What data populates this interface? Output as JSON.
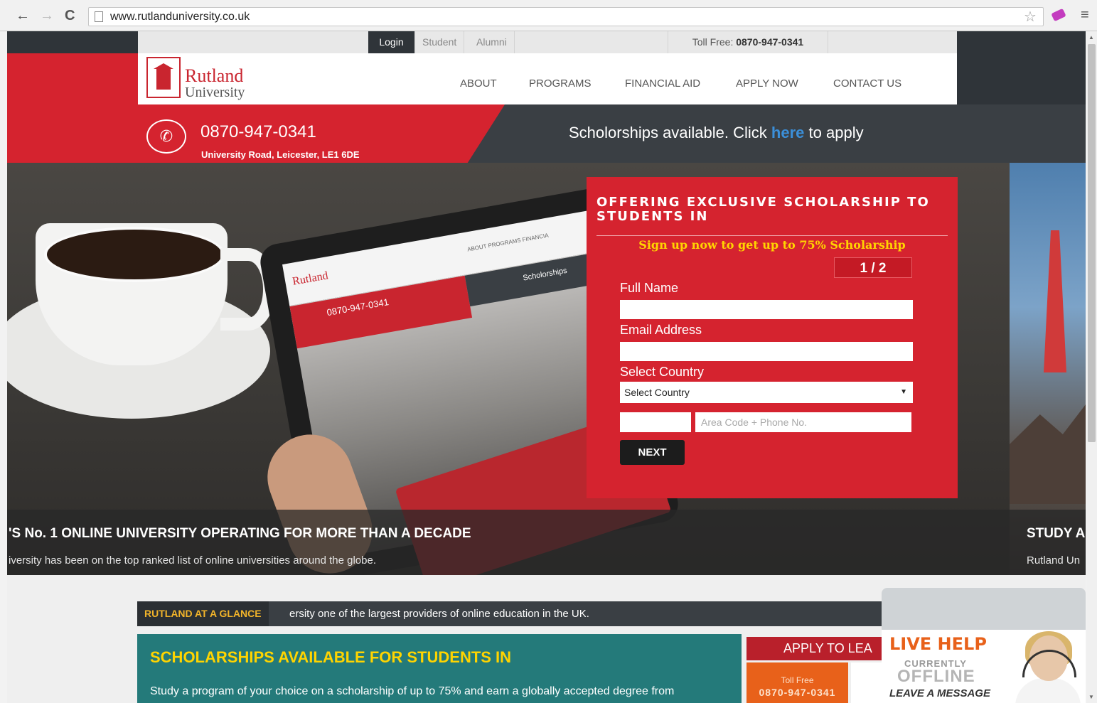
{
  "browser": {
    "url": "www.rutlanduniversity.co.uk",
    "back": "←",
    "forward": "→",
    "reload": "C",
    "star": "☆",
    "menu": "≡"
  },
  "topbar": {
    "tabs": [
      "Login",
      "Student",
      "Alumni"
    ],
    "toll_free_label": "Toll Free:",
    "toll_free_number": "0870-947-0341"
  },
  "logo": {
    "name": "Rutland",
    "sub": "University"
  },
  "nav": [
    "ABOUT",
    "PROGRAMS",
    "FINANCIAL AID",
    "APPLY NOW",
    "CONTACT US"
  ],
  "contact": {
    "phone": "0870-947-0341",
    "address": "University Road, Leicester, LE1 6DE",
    "scholar_pre": "Scholorships available. Click",
    "scholar_link": "here",
    "scholar_post": "to apply"
  },
  "hero": {
    "caption_title": "'S No. 1 ONLINE UNIVERSITY OPERATING FOR MORE THAN A DECADE",
    "caption_sub": "iversity has been on the top ranked list of online universities around the globe.",
    "right_title": "STUDY A",
    "right_sub": "Rutland Un",
    "tablet_logo": "Rutland",
    "tablet_phone": "0870-947-0341",
    "tablet_scholar": "Scholorships",
    "tablet_nav": "ABOUT   PROGRAMS   FINANCIA"
  },
  "form": {
    "title": "OFFERING EXCLUSIVE SCHOLARSHIP TO STUDENTS IN",
    "promo": "Sign up now to get up to 75% Scholarship",
    "step": "1 / 2",
    "full_name_label": "Full Name",
    "email_label": "Email Address",
    "country_label": "Select Country",
    "country_value": "Select Country",
    "phone_placeholder": "Area Code + Phone No.",
    "next_label": "NEXT"
  },
  "ticker": {
    "label": "RUTLAND AT A GLANCE",
    "text": "ersity one of the largest providers of online education in the UK."
  },
  "scholarship_panel": {
    "title": "SCHOLARSHIPS AVAILABLE FOR STUDENTS IN",
    "text": "Study a program of your choice on a scholarship of up to 75% and earn a globally accepted degree from"
  },
  "apply_panel": {
    "heading": "APPLY TO LEA",
    "toll_free": "Toll Free",
    "number": "0870-947-0341"
  },
  "live_help": {
    "title": "LIVE HELP",
    "currently": "CURRENTLY",
    "status": "OFFLINE",
    "action": "LEAVE A MESSAGE"
  },
  "colors": {
    "brand_red": "#d5232f",
    "dark": "#2f3439",
    "teal": "#247a7a",
    "accent_yellow": "#ffd400",
    "link_blue": "#3b8fd9"
  }
}
